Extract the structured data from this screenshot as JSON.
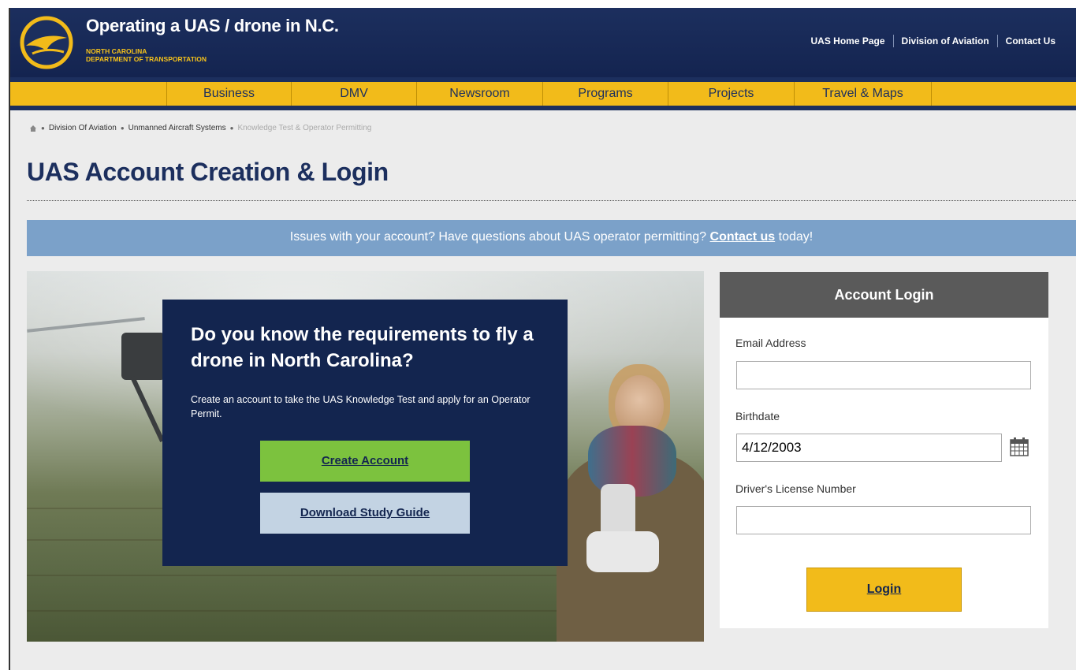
{
  "header": {
    "title": "Operating a UAS / drone in N.C.",
    "dept_line1": "NORTH CAROLINA",
    "dept_line2": "DEPARTMENT OF TRANSPORTATION",
    "links": [
      "UAS Home Page",
      "Division of Aviation",
      "Contact Us"
    ]
  },
  "nav": {
    "items": [
      "Business",
      "DMV",
      "Newsroom",
      "Programs",
      "Projects",
      "Travel & Maps"
    ]
  },
  "breadcrumb": [
    "Division Of Aviation",
    "Unmanned Aircraft Systems",
    "Knowledge Test & Operator Permitting"
  ],
  "page": {
    "title": "UAS Account Creation & Login"
  },
  "notice": {
    "before": "Issues with your account? Have questions about UAS operator permitting? ",
    "link": "Contact us",
    "after": " today!"
  },
  "promo": {
    "heading": "Do you know the requirements to fly a drone in North Carolina?",
    "text": "Create an account to take the UAS Knowledge Test and apply for an Operator Permit.",
    "create_label": "Create Account",
    "guide_label": "Download Study Guide"
  },
  "login": {
    "title": "Account Login",
    "email_label": "Email Address",
    "email_value": "",
    "birthdate_label": "Birthdate",
    "birthdate_value": "4/12/2003",
    "license_label": "Driver's License Number",
    "license_value": "",
    "submit_label": "Login"
  },
  "colors": {
    "navy": "#1c2f5e",
    "gold": "#f2bb1a",
    "notice_blue": "#7ba1c9",
    "green": "#7cc23e"
  }
}
